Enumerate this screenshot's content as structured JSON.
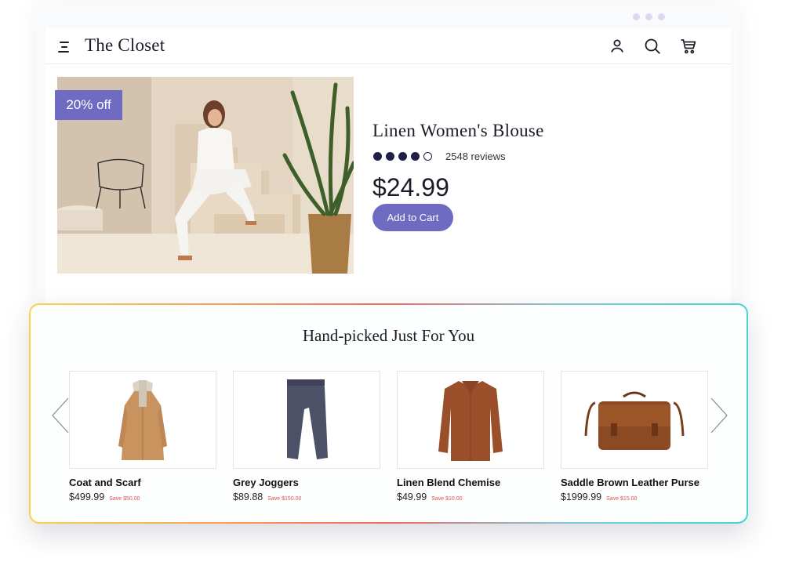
{
  "header": {
    "logo": "The Closet",
    "icons": [
      "menu-icon",
      "user-icon",
      "search-icon",
      "cart-icon"
    ]
  },
  "hero": {
    "badge": "20% off",
    "title": "Linen Women's Blouse",
    "rating": 4,
    "rating_max": 5,
    "reviews": "2548 reviews",
    "price": "$24.99",
    "cta": "Add to Cart"
  },
  "recommendations": {
    "title": "Hand-picked Just For You",
    "items": [
      {
        "name": "Coat and Scarf",
        "price": "$499.99",
        "save": "Save $50.00"
      },
      {
        "name": "Grey Joggers",
        "price": "$89.88",
        "save": "Save $150.00"
      },
      {
        "name": "Linen Blend Chemise",
        "price": "$49.99",
        "save": "Save $10.00"
      },
      {
        "name": "Saddle Brown Leather Purse",
        "price": "$1999.99",
        "save": "Save $15.00"
      }
    ]
  },
  "colors": {
    "accent": "#6f6bc3",
    "rating_dots": "#202047",
    "save_text": "#e0524d",
    "panel_gradient": [
      "#f6d54a",
      "#ee6b61",
      "#3fd6d0"
    ]
  }
}
